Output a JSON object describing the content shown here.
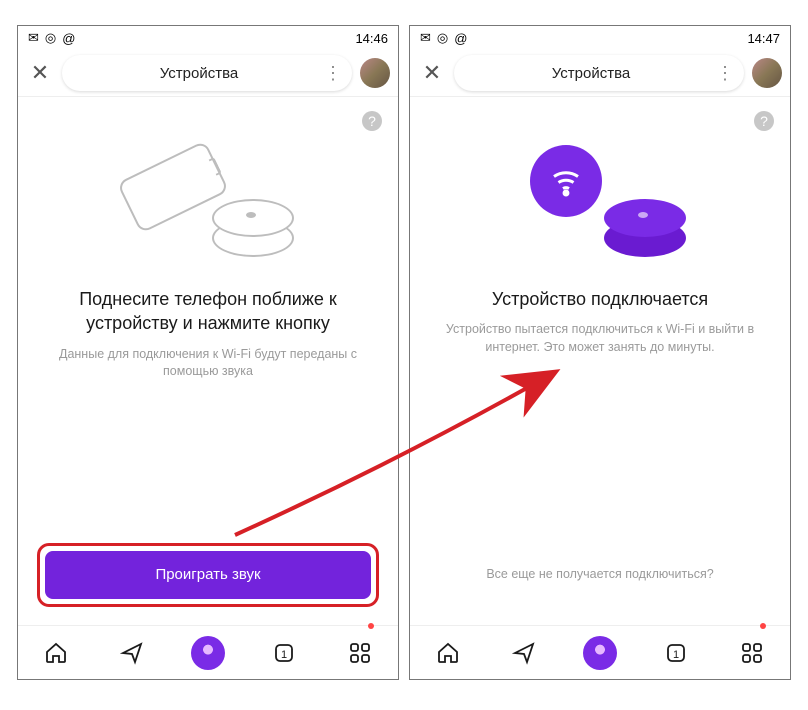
{
  "screens": [
    {
      "status_time": "14:46",
      "header_title": "Устройства",
      "title": "Поднесите телефон поближе к устройству и нажмите кнопку",
      "subtitle": "Данные для подключения к Wi-Fi будут переданы с помощью звука",
      "button_label": "Проиграть звук"
    },
    {
      "status_time": "14:47",
      "header_title": "Устройства",
      "title": "Устройство подключается",
      "subtitle": "Устройство пытается подключиться к Wi-Fi и выйти в интернет. Это может занять до минуты.",
      "bottom_link": "Все еще не получается подключиться?"
    }
  ],
  "colors": {
    "accent": "#7323dc",
    "highlight": "#d62026"
  }
}
